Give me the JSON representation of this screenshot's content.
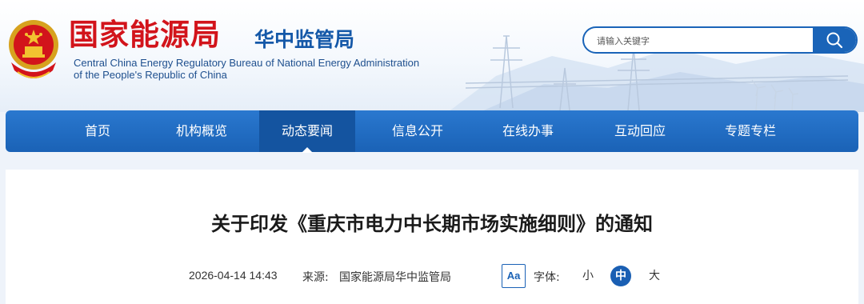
{
  "brand": {
    "title": "国家能源局",
    "subtitle": "华中监管局",
    "english_line1": "Central China Energy Regulatory Bureau of National Energy Administration",
    "english_line2": "of the People's Republic of China",
    "emblem_icon": "national-emblem-icon"
  },
  "search": {
    "placeholder": "请输入关键字",
    "button_icon": "search-icon"
  },
  "nav": {
    "items": [
      {
        "label": "首页"
      },
      {
        "label": "机构概览"
      },
      {
        "label": "动态要闻",
        "active": true
      },
      {
        "label": "信息公开"
      },
      {
        "label": "在线办事"
      },
      {
        "label": "互动回应"
      },
      {
        "label": "专题专栏"
      }
    ]
  },
  "article": {
    "title": "关于印发《重庆市电力中长期市场实施细则》的通知",
    "date": "2026-04-14 14:43",
    "source_label": "来源:",
    "source": "国家能源局华中监管局",
    "font_icon_text": "Aa",
    "font_label": "字体:",
    "sizes": [
      "小",
      "中",
      "大"
    ],
    "active_size": "中"
  },
  "colors": {
    "brand_red": "#d2141b",
    "brand_blue": "#1458a8",
    "nav_blue": "#1a62b6",
    "active_nav": "#1454a0"
  }
}
